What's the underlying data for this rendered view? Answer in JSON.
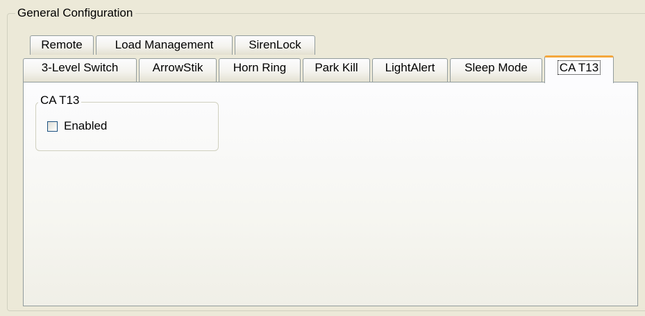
{
  "group": {
    "title": "General Configuration"
  },
  "tabs_row1": [
    {
      "label": "Remote"
    },
    {
      "label": "Load Management"
    },
    {
      "label": "SirenLock"
    }
  ],
  "tabs_row2": [
    {
      "label": "3-Level Switch"
    },
    {
      "label": "ArrowStik"
    },
    {
      "label": "Horn Ring"
    },
    {
      "label": "Park Kill"
    },
    {
      "label": "LightAlert"
    },
    {
      "label": "Sleep Mode"
    },
    {
      "label": "CA T13"
    }
  ],
  "selected_tab": "CA T13",
  "panel": {
    "group_title": "CA T13",
    "checkbox": {
      "label": "Enabled",
      "checked": false
    }
  },
  "colors": {
    "background": "#ece9d8",
    "tab_border": "#919b9c",
    "selected_tab_accent": "#f4a73c",
    "checkbox_border": "#1c5180"
  }
}
